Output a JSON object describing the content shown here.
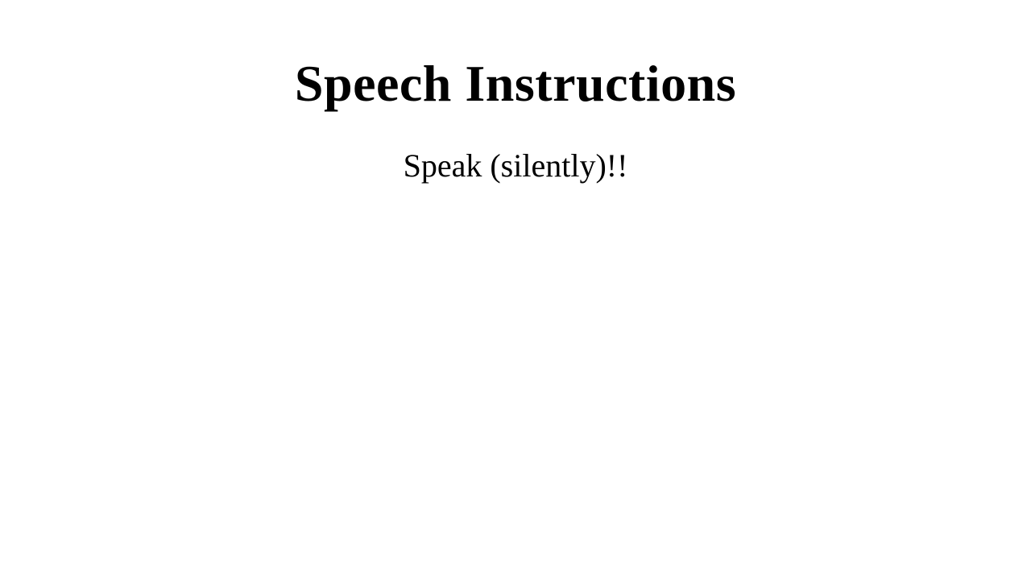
{
  "page": {
    "title": "Speech Instructions",
    "instruction": "Speak (silently)!!"
  },
  "colors": {
    "background": "#ffffff",
    "text": "#000000"
  }
}
